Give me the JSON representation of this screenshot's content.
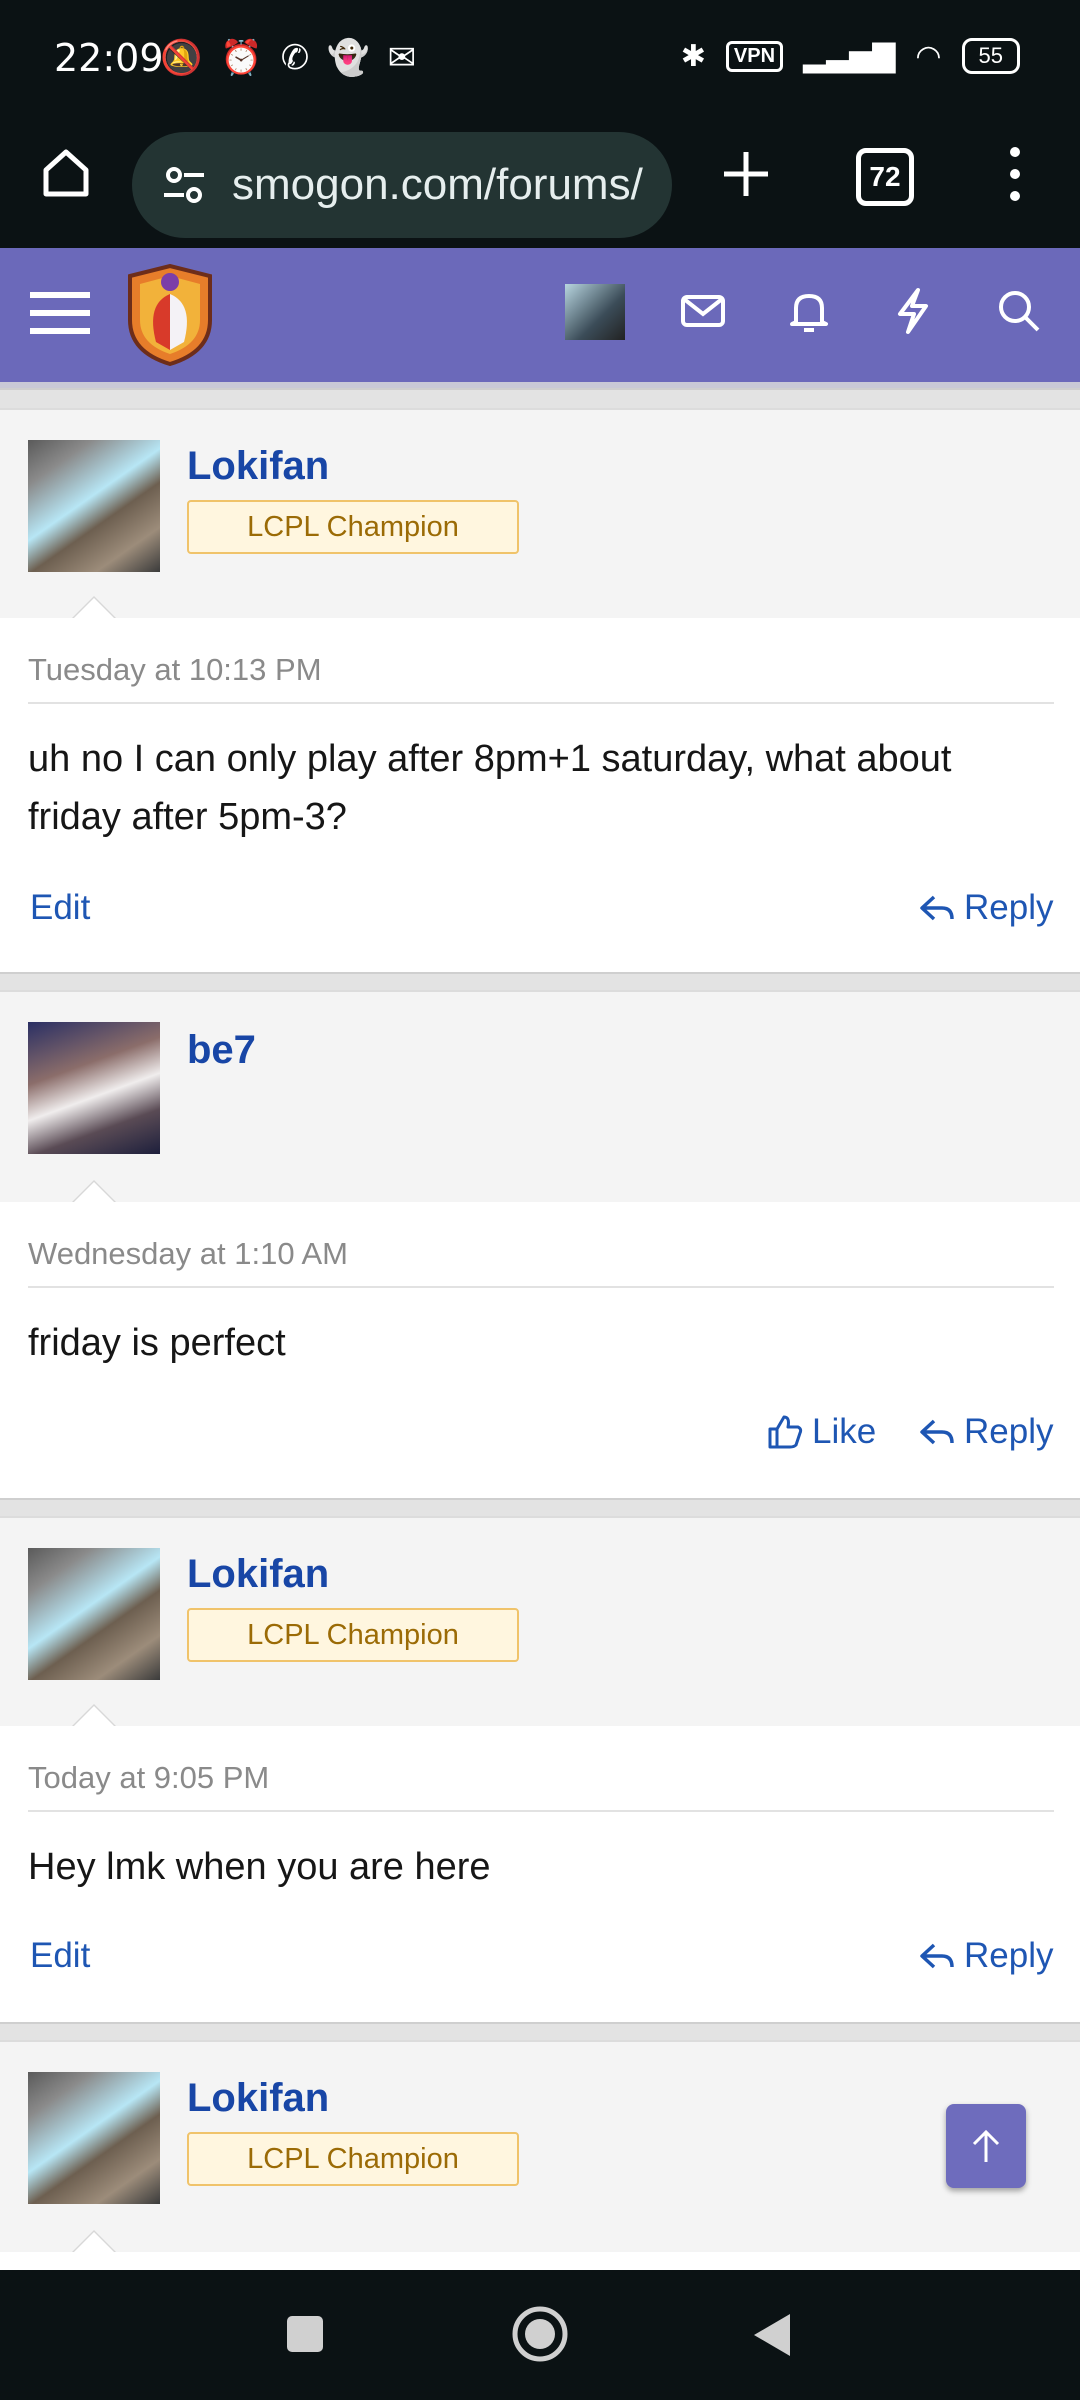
{
  "status_bar": {
    "time": "22:09",
    "vpn_label": "VPN",
    "battery": "55"
  },
  "browser": {
    "url": "smogon.com/forums/",
    "tab_count": "72"
  },
  "posts": [
    {
      "username": "Lokifan",
      "badge": "LCPL Champion",
      "date": "Tuesday at 10:13 PM",
      "text": "uh no I can only play after 8pm+1 saturday, what about friday after 5pm-3?",
      "left_action": "Edit",
      "reply_label": "Reply"
    },
    {
      "username": "be7",
      "date": "Wednesday at 1:10 AM",
      "text": "friday is perfect",
      "like_label": "Like",
      "reply_label": "Reply"
    },
    {
      "username": "Lokifan",
      "badge": "LCPL Champion",
      "date": "Today at 9:05 PM",
      "text": "Hey lmk when you are here",
      "left_action": "Edit",
      "reply_label": "Reply"
    },
    {
      "username": "Lokifan",
      "badge": "LCPL Champion"
    }
  ],
  "colors": {
    "site_bar": "#6b69ba",
    "link": "#1846a6",
    "badge_text": "#9b6b06",
    "badge_bg": "#fff6df"
  }
}
